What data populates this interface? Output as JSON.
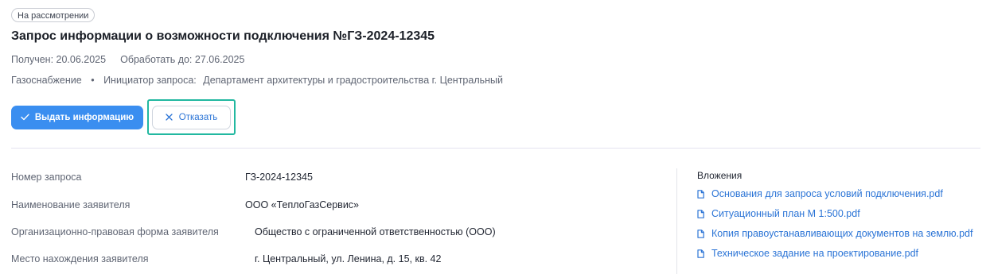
{
  "status_badge": "На рассмотрении",
  "title": "Запрос информации о возможности подключения №ГЗ-2024-12345",
  "dates": {
    "received": "Получен: 20.06.2025",
    "deadline": "Обработать до: 27.06.2025"
  },
  "meta": {
    "service": "Газоснабжение",
    "separator": "•",
    "initiator_label": "Инициатор запроса:",
    "initiator_value": "Департамент архитектуры и градостроительства г. Центральный"
  },
  "actions": {
    "issue_label": "Выдать информацию",
    "issue_icon": "check-icon",
    "reject_label": "Отказать",
    "reject_icon": "close-icon",
    "primary_color": "#3a8ef0",
    "highlight_color": "#22b8a0"
  },
  "details": [
    {
      "label": "Номер запроса",
      "value": "ГЗ-2024-12345"
    },
    {
      "label": "Наименование заявителя",
      "value": "ООО «ТеплоГазСервис»"
    },
    {
      "label": "Организационно-правовая форма заявителя",
      "value": "Общество с ограниченной ответственностью (ООО)"
    },
    {
      "label": "Место нахождения заявителя",
      "value": "г. Центральный, ул. Ленина, д. 15, кв. 42"
    }
  ],
  "attachments": {
    "title": "Вложения",
    "icon": "file-icon",
    "link_color": "#2b74d6",
    "items": [
      "Основания для запроса условий подключения.pdf",
      "Ситуационный план М 1:500.pdf",
      "Копия правоустанавливающих документов на землю.pdf",
      "Техническое задание на проектирование.pdf"
    ]
  }
}
